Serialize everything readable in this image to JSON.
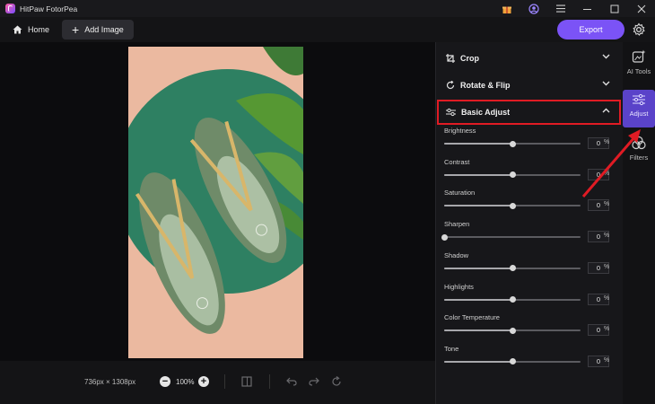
{
  "window": {
    "title": "HitPaw FotorPea",
    "icons": [
      "gift-icon",
      "account-icon",
      "menu-icon",
      "minimize-icon",
      "maximize-icon",
      "close-icon"
    ]
  },
  "toolbar": {
    "home_label": "Home",
    "add_image_label": "Add Image",
    "export_label": "Export",
    "accent": "#7b53f6"
  },
  "canvas": {
    "dimensions": "736px × 1308px",
    "zoom": "100%"
  },
  "panel": {
    "sections": [
      {
        "label": "Crop",
        "icon": "crop-icon",
        "expanded": false
      },
      {
        "label": "Rotate & Flip",
        "icon": "rotate-icon",
        "expanded": false
      },
      {
        "label": "Basic Adjust",
        "icon": "adjust-icon",
        "expanded": true
      }
    ],
    "adjustments": [
      {
        "label": "Brightness",
        "value": "0",
        "unit": "%",
        "level": 0.5
      },
      {
        "label": "Contrast",
        "value": "0",
        "unit": "%",
        "level": 0.5
      },
      {
        "label": "Saturation",
        "value": "0",
        "unit": "%",
        "level": 0.5
      },
      {
        "label": "Sharpen",
        "value": "0",
        "unit": "%",
        "level": 0.0
      },
      {
        "label": "Shadow",
        "value": "0",
        "unit": "%",
        "level": 0.5
      },
      {
        "label": "Highlights",
        "value": "0",
        "unit": "%",
        "level": 0.5
      },
      {
        "label": "Color Temperature",
        "value": "0",
        "unit": "%",
        "level": 0.5
      },
      {
        "label": "Tone",
        "value": "0",
        "unit": "%",
        "level": 0.5
      }
    ]
  },
  "rail": {
    "items": [
      {
        "label": "AI Tools",
        "icon": "ai-tools-icon",
        "active": false
      },
      {
        "label": "Adjust",
        "icon": "adjust-sliders-icon",
        "active": true
      },
      {
        "label": "Filters",
        "icon": "filters-icon",
        "active": false
      }
    ]
  },
  "annotation": {
    "highlight_color": "#e01b24"
  }
}
